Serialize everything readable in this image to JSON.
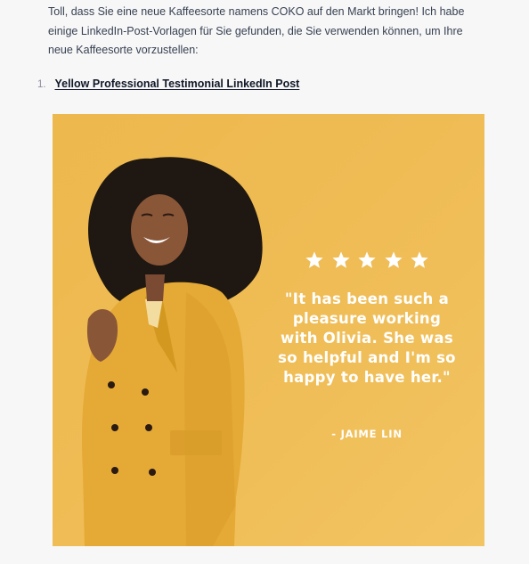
{
  "message": {
    "intro_text": "Toll, dass Sie eine neue Kaffeesorte namens COKO auf den Markt bringen! Ich habe einige LinkedIn-Post-Vorlagen für Sie gefunden, die Sie verwenden können, um Ihre neue Kaffeesorte vorzustellen:"
  },
  "list": {
    "items": [
      {
        "number": "1.",
        "label": "Yellow Professional Testimonial LinkedIn Post"
      }
    ]
  },
  "template_preview": {
    "rating_stars": 5,
    "quote": "\"It has been such a pleasure working with Olivia. She was so helpful and I'm so happy to have her.\"",
    "author": "- JAIME LIN",
    "colors": {
      "background": "#efbc55",
      "text": "#ffffff",
      "coat": "#e5a935"
    }
  }
}
